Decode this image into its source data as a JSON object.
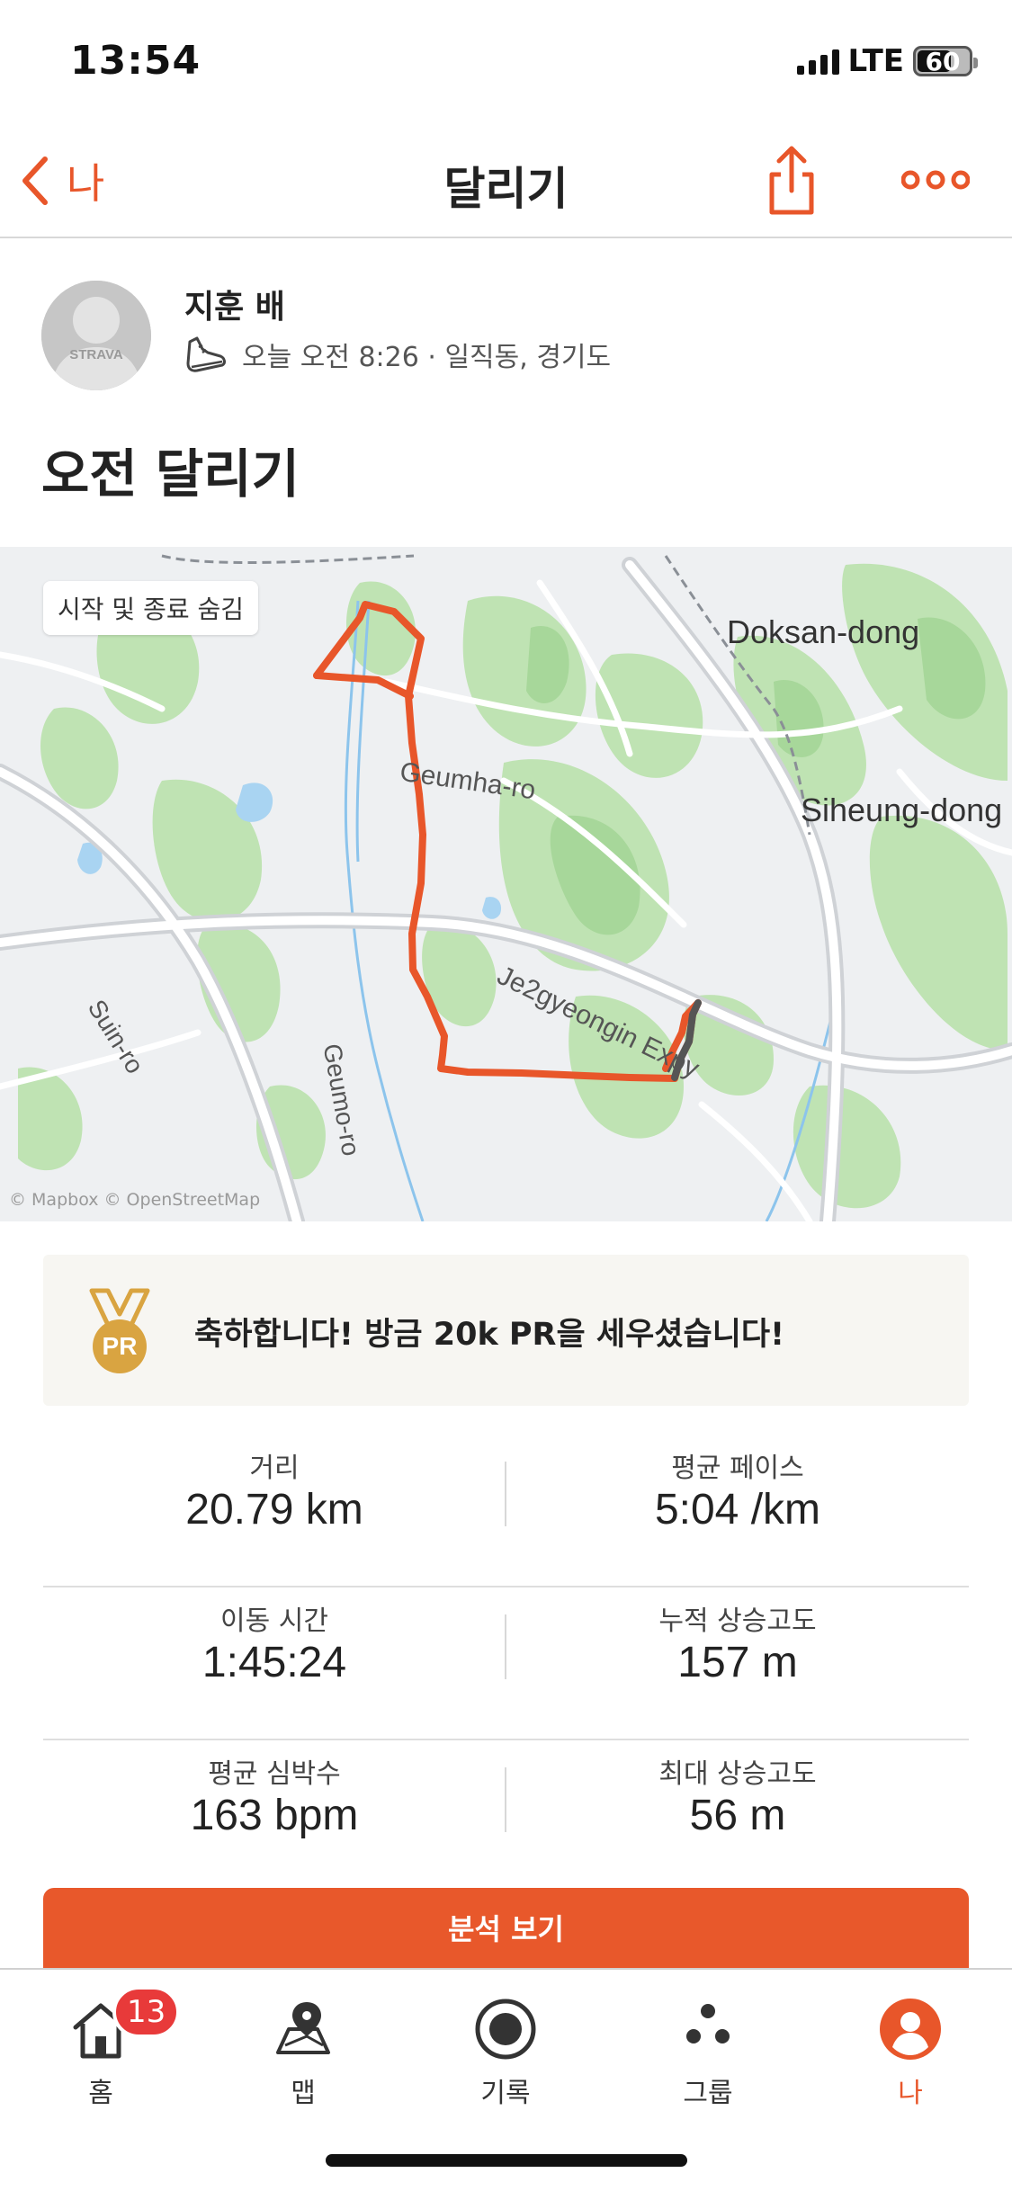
{
  "status_bar": {
    "time": "13:54",
    "network": "LTE",
    "battery": "60"
  },
  "header": {
    "back_label": "나",
    "title": "달리기"
  },
  "athlete": {
    "name": "지훈 배",
    "avatar_text": "STRAVA",
    "meta": "오늘 오전 8:26 · 일직동, 경기도"
  },
  "activity": {
    "title": "오전 달리기"
  },
  "map": {
    "hide_start_end_label": "시작 및 종료 숨김",
    "labels": {
      "doksan": "Doksan-dong",
      "siheung": "Siheung-dong",
      "geumha": "Geumha-ro",
      "je2": "Je2gyeongin Expy",
      "suin": "Suin-ro",
      "geumo": "Geumo-ro"
    },
    "attribution": "© Mapbox © OpenStreetMap",
    "route_color": "#e8562a"
  },
  "pr_banner": {
    "medal_text": "PR",
    "text": "축하합니다! 방금 20k PR을 세우셨습니다!"
  },
  "stats": [
    {
      "left": {
        "label": "거리",
        "value": "20.79 km"
      },
      "right": {
        "label": "평균 페이스",
        "value": "5:04 /km"
      }
    },
    {
      "left": {
        "label": "이동 시간",
        "value": "1:45:24"
      },
      "right": {
        "label": "누적 상승고도",
        "value": "157 m"
      }
    },
    {
      "left": {
        "label": "평균 심박수",
        "value": "163 bpm"
      },
      "right": {
        "label": "최대 상승고도",
        "value": "56 m"
      }
    }
  ],
  "analysis_button": "분석 보기",
  "tabs": [
    {
      "label": "홈",
      "icon": "home-icon",
      "badge": "13"
    },
    {
      "label": "맵",
      "icon": "map-icon"
    },
    {
      "label": "기록",
      "icon": "record-icon"
    },
    {
      "label": "그룹",
      "icon": "groups-icon"
    },
    {
      "label": "나",
      "icon": "profile-icon",
      "active": true
    }
  ],
  "colors": {
    "accent": "#e8562a",
    "badge": "#e83a3a",
    "medal": "#d9a441"
  }
}
